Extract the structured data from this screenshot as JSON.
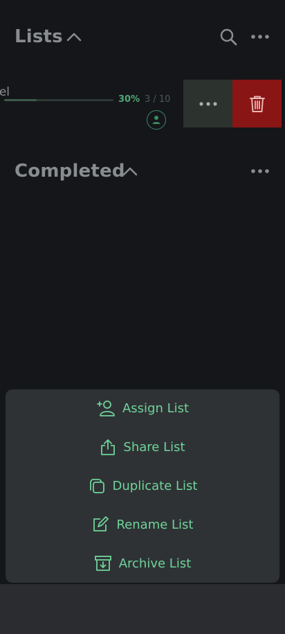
{
  "lists_section": {
    "title": "Lists"
  },
  "list_item": {
    "name_visible": "el",
    "progress_percent": 30,
    "percent_label": "30%",
    "count_label": "3 / 10"
  },
  "completed_section": {
    "title": "Completed"
  },
  "menu": {
    "items": [
      {
        "label": "Assign List",
        "icon": "assign-user-icon"
      },
      {
        "label": "Share List",
        "icon": "share-icon"
      },
      {
        "label": "Duplicate List",
        "icon": "duplicate-icon"
      },
      {
        "label": "Rename List",
        "icon": "rename-icon"
      },
      {
        "label": "Archive List",
        "icon": "archive-icon"
      }
    ]
  },
  "colors": {
    "accent": "#6fd49a",
    "delete": "#8a1515",
    "background": "#151619",
    "sheet": "#2f3235"
  }
}
